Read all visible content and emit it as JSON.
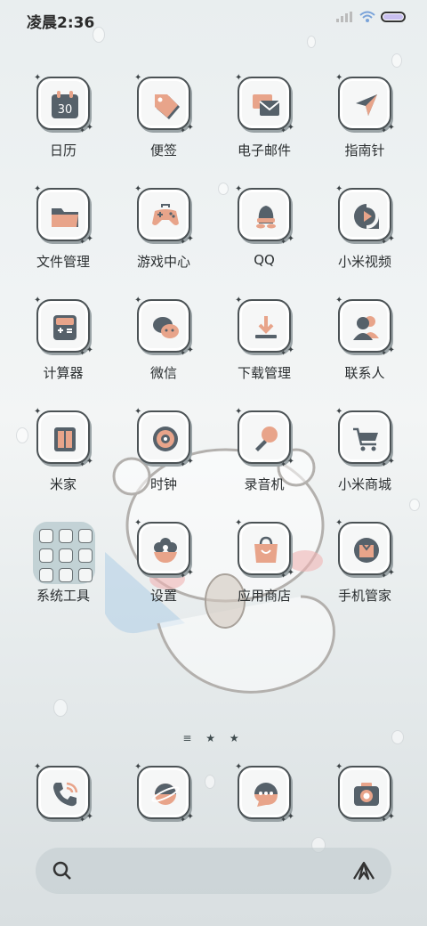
{
  "status_bar": {
    "time": "凌晨2:36"
  },
  "home": {
    "rows": [
      [
        {
          "label": "日历",
          "icon": "calendar-icon",
          "badge": "30"
        },
        {
          "label": "便签",
          "icon": "notes-tag-icon"
        },
        {
          "label": "电子邮件",
          "icon": "email-icon"
        },
        {
          "label": "指南针",
          "icon": "compass-icon"
        }
      ],
      [
        {
          "label": "文件管理",
          "icon": "folder-icon"
        },
        {
          "label": "游戏中心",
          "icon": "gamepad-icon"
        },
        {
          "label": "QQ",
          "icon": "qq-penguin-icon"
        },
        {
          "label": "小米视频",
          "icon": "video-play-icon"
        }
      ],
      [
        {
          "label": "计算器",
          "icon": "calculator-icon"
        },
        {
          "label": "微信",
          "icon": "wechat-icon"
        },
        {
          "label": "下载管理",
          "icon": "download-icon"
        },
        {
          "label": "联系人",
          "icon": "contacts-icon"
        }
      ],
      [
        {
          "label": "米家",
          "icon": "mijia-icon"
        },
        {
          "label": "时钟",
          "icon": "clock-icon"
        },
        {
          "label": "录音机",
          "icon": "microphone-icon"
        },
        {
          "label": "小米商城",
          "icon": "shopping-cart-icon"
        }
      ],
      [
        {
          "label": "系统工具",
          "icon": "folder-grid-icon"
        },
        {
          "label": "设置",
          "icon": "settings-flower-icon"
        },
        {
          "label": "应用商店",
          "icon": "store-bag-icon"
        },
        {
          "label": "手机管家",
          "icon": "security-icon"
        }
      ]
    ]
  },
  "page_indicator": {
    "text": "≡ ★ ★"
  },
  "dock": {
    "apps": [
      {
        "icon": "phone-icon"
      },
      {
        "icon": "browser-planet-icon"
      },
      {
        "icon": "messages-icon"
      },
      {
        "icon": "camera-icon"
      }
    ]
  },
  "search_bar": {
    "search_icon": "search-icon",
    "assistant_icon": "assistant-icon"
  },
  "colors": {
    "accent_orange": "#e8a48a",
    "icon_dark": "#4f5b5e",
    "tile_border": "#4b5255"
  }
}
